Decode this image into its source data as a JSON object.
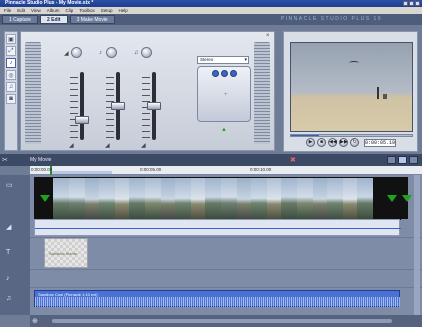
{
  "window": {
    "title": "Pinnacle Studio Plus - My Movie.stx *"
  },
  "menu": [
    "File",
    "Edit",
    "View",
    "Album",
    "Clip",
    "Toolbox",
    "Setup",
    "Help"
  ],
  "tabs": [
    {
      "label": "1 Capture",
      "active": false
    },
    {
      "label": "2 Edit",
      "active": true
    },
    {
      "label": "3 Make Movie",
      "active": false
    }
  ],
  "brand": "PINNACLE STUDIO PLUS 10",
  "mixer": {
    "surround_mode": "Stereo"
  },
  "player": {
    "timecode": "0:00:05.19"
  },
  "timeline": {
    "project_name": "My Movie",
    "ruler_ticks": [
      "0:00:00.00",
      "0:00:05.00",
      "0:00:10.00"
    ],
    "title_clip_label": "Sandbox theme",
    "music_clip_label": "Sandbox Cool (Pinnacle 1:10 ext)"
  },
  "icons": {
    "tools": [
      "video-tools-icon",
      "transition-icon",
      "audio-tools-icon",
      "effects-icon",
      "music-icon",
      "voice-icon"
    ],
    "track_heads": [
      "video-track-icon",
      "audio-track-icon",
      "title-track-icon",
      "sound-effect-track-icon",
      "music-track-icon"
    ]
  },
  "colors": {
    "accent": "#3a62c8",
    "title_bar": "#2c4fa8",
    "music_clip": "#4a72d6"
  }
}
